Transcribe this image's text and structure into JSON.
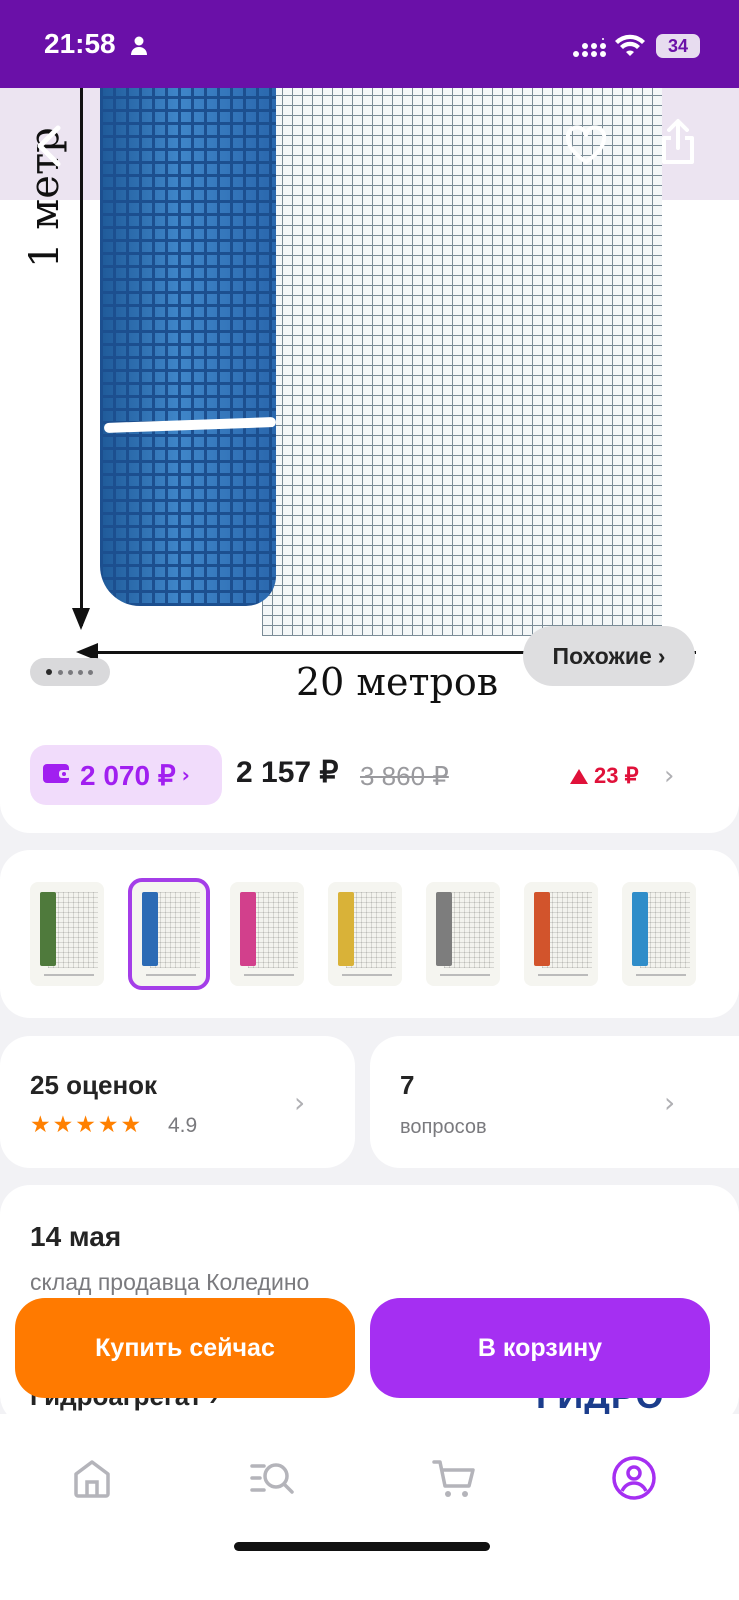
{
  "status_bar": {
    "time": "21:58",
    "battery": "34",
    "icons": [
      "person-icon",
      "signal-icon",
      "wifi-icon",
      "battery-icon"
    ]
  },
  "product_image": {
    "label_height": "1 метр",
    "label_width": "20 метров",
    "gallery_count": 5,
    "gallery_active_index": 0
  },
  "header_actions": {
    "icons": [
      "back-arrow-icon",
      "heart-icon",
      "share-icon"
    ]
  },
  "similar_button": {
    "label": "Похожие"
  },
  "price": {
    "wallet_price": "2 070 ₽",
    "current_price": "2 157 ₽",
    "old_price": "3 860 ₽",
    "change": "23 ₽"
  },
  "variants": {
    "selected_index": 1,
    "items": [
      {
        "name": "green",
        "color": "#4f7a3c"
      },
      {
        "name": "blue",
        "color": "#2c6bb5"
      },
      {
        "name": "pink",
        "color": "#d2408c"
      },
      {
        "name": "yellow",
        "color": "#d9b238"
      },
      {
        "name": "gray",
        "color": "#7d7d7d"
      },
      {
        "name": "orange",
        "color": "#d2542c"
      },
      {
        "name": "light-blue",
        "color": "#2f8dc9"
      }
    ]
  },
  "reviews": {
    "title": "25 оценок",
    "rating": "4.9",
    "stars": 5
  },
  "questions": {
    "count": "7",
    "label": "вопросов"
  },
  "delivery": {
    "date": "14 мая",
    "place": "склад продавца Коледино"
  },
  "brand": {
    "name": "Гидроагрегат ›",
    "logo_text": "ГИДРО"
  },
  "actions": {
    "buy_now": "Купить сейчас",
    "to_cart": "В корзину"
  },
  "bottom_nav": {
    "items": [
      "home-icon",
      "catalog-search-icon",
      "cart-icon",
      "profile-icon"
    ],
    "active_index": 3
  },
  "colors": {
    "brand_purple": "#6a10a8",
    "accent_purple": "#a52ff2",
    "orange": "#ff7a00",
    "price_up_red": "#e0113a",
    "star_orange": "#ff8000"
  }
}
